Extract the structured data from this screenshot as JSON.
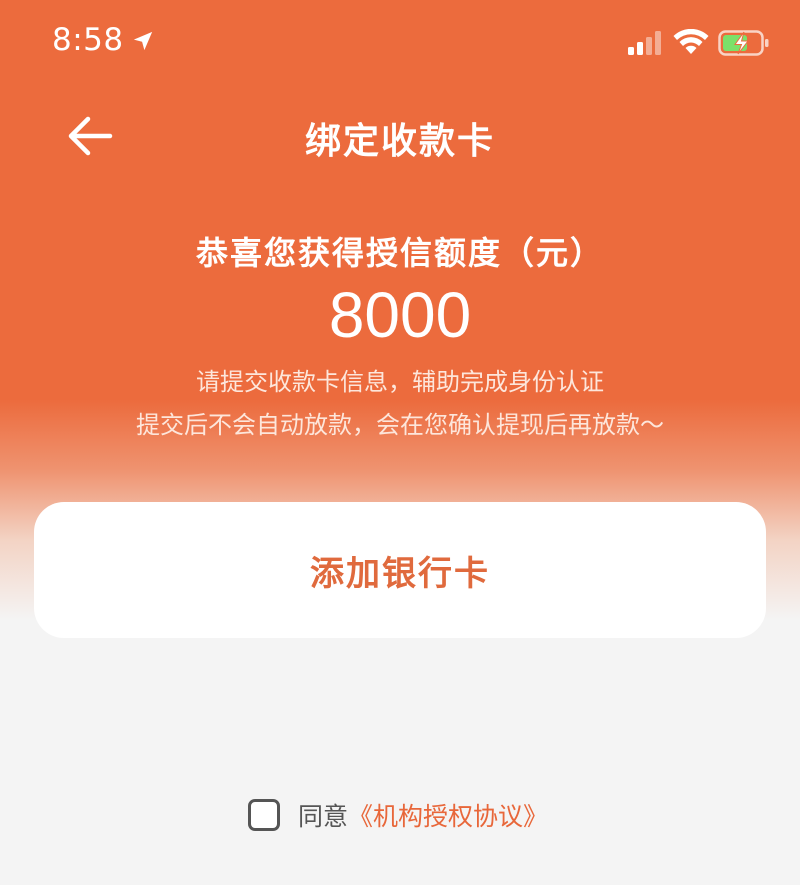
{
  "status_bar": {
    "time": "8:58",
    "icons": [
      "location-arrow-icon",
      "cellular-signal-icon",
      "wifi-icon",
      "battery-charging-icon"
    ]
  },
  "nav": {
    "back_icon": "arrow-left-icon",
    "title": "绑定收款卡"
  },
  "hero": {
    "label": "恭喜您获得授信额度（元）",
    "amount": "8000",
    "note_line1": "请提交收款卡信息，辅助完成身份认证",
    "note_line2": "提交后不会自动放款，会在您确认提现后再放款～"
  },
  "card": {
    "add_bank_card_label": "添加银行卡"
  },
  "agreement": {
    "checked": false,
    "prefix": "同意",
    "link": "《机构授权协议》"
  },
  "colors": {
    "brand_orange": "#EC6B3D",
    "link_orange": "#E8673A",
    "background_gray": "#F4F4F4"
  }
}
